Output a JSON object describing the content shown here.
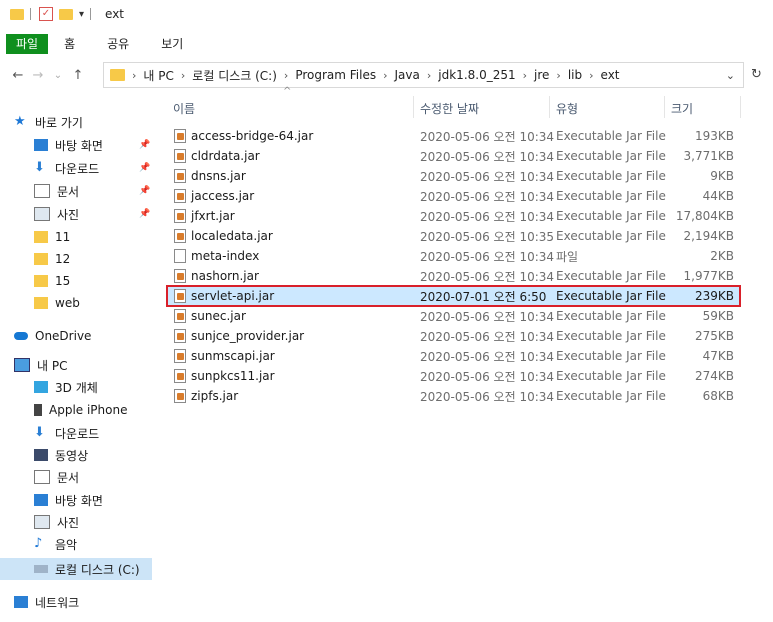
{
  "window": {
    "title": "ext"
  },
  "ribbon": {
    "tabs": [
      "파일",
      "홈",
      "공유",
      "보기"
    ]
  },
  "address": {
    "crumbs": [
      "내 PC",
      "로컬 디스크 (C:)",
      "Program Files",
      "Java",
      "jdk1.8.0_251",
      "jre",
      "lib",
      "ext"
    ]
  },
  "columns": {
    "name": "이름",
    "date": "수정한 날짜",
    "type": "유형",
    "size": "크기"
  },
  "sidebar": {
    "items": [
      {
        "label": "바로 가기",
        "icon": "star-icon"
      },
      {
        "label": "바탕 화면",
        "icon": "desktop-icon",
        "pinned": true
      },
      {
        "label": "다운로드",
        "icon": "download-icon",
        "pinned": true
      },
      {
        "label": "문서",
        "icon": "document-icon",
        "pinned": true
      },
      {
        "label": "사진",
        "icon": "picture-icon",
        "pinned": true
      },
      {
        "label": "11",
        "icon": "folder-icon"
      },
      {
        "label": "12",
        "icon": "folder-icon"
      },
      {
        "label": "15",
        "icon": "folder-icon"
      },
      {
        "label": "web",
        "icon": "folder-icon"
      },
      {
        "label": "OneDrive",
        "icon": "cloud-icon"
      },
      {
        "label": "내 PC",
        "icon": "pc-icon"
      },
      {
        "label": "3D 개체",
        "icon": "cube-icon"
      },
      {
        "label": "Apple iPhone",
        "icon": "phone-icon"
      },
      {
        "label": "다운로드",
        "icon": "download-icon"
      },
      {
        "label": "동영상",
        "icon": "video-icon"
      },
      {
        "label": "문서",
        "icon": "document-icon"
      },
      {
        "label": "바탕 화면",
        "icon": "desktop-icon"
      },
      {
        "label": "사진",
        "icon": "picture-icon"
      },
      {
        "label": "음악",
        "icon": "music-icon"
      },
      {
        "label": "로컬 디스크 (C:)",
        "icon": "drive-icon",
        "selected": true
      },
      {
        "label": "네트워크",
        "icon": "network-icon"
      }
    ]
  },
  "files": [
    {
      "name": "access-bridge-64.jar",
      "date": "2020-05-06 오전 10:34",
      "type": "Executable Jar File",
      "size": "193KB",
      "icon": "jar-icon"
    },
    {
      "name": "cldrdata.jar",
      "date": "2020-05-06 오전 10:34",
      "type": "Executable Jar File",
      "size": "3,771KB",
      "icon": "jar-icon"
    },
    {
      "name": "dnsns.jar",
      "date": "2020-05-06 오전 10:34",
      "type": "Executable Jar File",
      "size": "9KB",
      "icon": "jar-icon"
    },
    {
      "name": "jaccess.jar",
      "date": "2020-05-06 오전 10:34",
      "type": "Executable Jar File",
      "size": "44KB",
      "icon": "jar-icon"
    },
    {
      "name": "jfxrt.jar",
      "date": "2020-05-06 오전 10:34",
      "type": "Executable Jar File",
      "size": "17,804KB",
      "icon": "jar-icon"
    },
    {
      "name": "localedata.jar",
      "date": "2020-05-06 오전 10:35",
      "type": "Executable Jar File",
      "size": "2,194KB",
      "icon": "jar-icon"
    },
    {
      "name": "meta-index",
      "date": "2020-05-06 오전 10:34",
      "type": "파일",
      "size": "2KB",
      "icon": "file-icon"
    },
    {
      "name": "nashorn.jar",
      "date": "2020-05-06 오전 10:34",
      "type": "Executable Jar File",
      "size": "1,977KB",
      "icon": "jar-icon"
    },
    {
      "name": "servlet-api.jar",
      "date": "2020-07-01 오전 6:50",
      "type": "Executable Jar File",
      "size": "239KB",
      "icon": "jar-icon",
      "selected": true
    },
    {
      "name": "sunec.jar",
      "date": "2020-05-06 오전 10:34",
      "type": "Executable Jar File",
      "size": "59KB",
      "icon": "jar-icon"
    },
    {
      "name": "sunjce_provider.jar",
      "date": "2020-05-06 오전 10:34",
      "type": "Executable Jar File",
      "size": "275KB",
      "icon": "jar-icon"
    },
    {
      "name": "sunmscapi.jar",
      "date": "2020-05-06 오전 10:34",
      "type": "Executable Jar File",
      "size": "47KB",
      "icon": "jar-icon"
    },
    {
      "name": "sunpkcs11.jar",
      "date": "2020-05-06 오전 10:34",
      "type": "Executable Jar File",
      "size": "274KB",
      "icon": "jar-icon"
    },
    {
      "name": "zipfs.jar",
      "date": "2020-05-06 오전 10:34",
      "type": "Executable Jar File",
      "size": "68KB",
      "icon": "jar-icon"
    }
  ]
}
